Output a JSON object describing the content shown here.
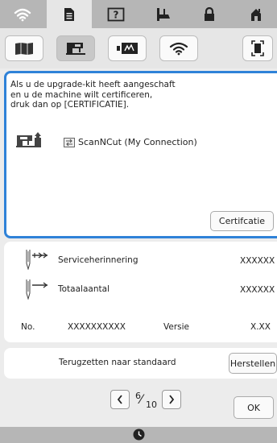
{
  "tabs": [
    {
      "icon": "wifi-icon"
    },
    {
      "icon": "page-icon"
    },
    {
      "icon": "help-icon"
    },
    {
      "icon": "embroidery-foot-icon"
    },
    {
      "icon": "lock-icon"
    },
    {
      "icon": "home-icon"
    }
  ],
  "active_tab": 1,
  "categories": [
    {
      "icon": "book-icon"
    },
    {
      "icon": "sewing-machine-icon"
    },
    {
      "icon": "embroidery-icon"
    },
    {
      "icon": "wifi-icon"
    }
  ],
  "active_category": 1,
  "scan_icon": "screenshot-icon",
  "panel": {
    "message_lines": [
      "Als u de upgrade-kit heeft aangeschaft",
      "en u de machine wilt certificeren,",
      "druk dan op [CERTIFICATIE]."
    ],
    "connection_label": "ScanNCut (My Connection)",
    "certify_button": "Certifcatie"
  },
  "info": {
    "service_label": "Serviceherinnering",
    "service_value": "XXXXXX",
    "total_label": "Totaalaantal",
    "total_value": "XXXXXX",
    "number_label": "No.",
    "number_value": "XXXXXXXXXX",
    "version_label": "Versie",
    "version_value": "X.XX"
  },
  "reset": {
    "label": "Terugzetten naar standaard",
    "button": "Herstellen"
  },
  "pager": {
    "current": "6",
    "total": "10"
  },
  "ok_button": "OK",
  "colors": {
    "accent": "#2f82d8",
    "tabbar": "#b6b6b6",
    "background": "#ececec"
  }
}
